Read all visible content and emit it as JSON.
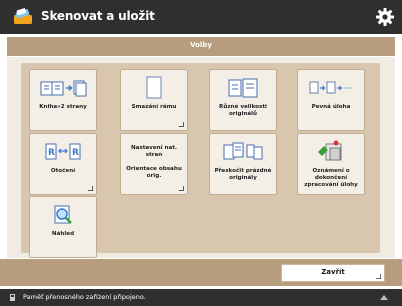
{
  "header": {
    "title": "Skenovat a uložit",
    "settings_icon": "gear-icon"
  },
  "subheader": {
    "title": "Volby"
  },
  "options": [
    {
      "id": "two-sided",
      "label": "Kniha»2 strany",
      "icon": "book-to-two-pages-icon"
    },
    {
      "id": "erase-frame",
      "label": "Smazání rámu",
      "icon": "blank-page-icon"
    },
    {
      "id": "mixed-originals",
      "label": "Různé velikosti originálů",
      "icon": "mixed-size-originals-icon"
    },
    {
      "id": "job-build",
      "label": "Pevná úloha",
      "icon": "job-build-icon"
    },
    {
      "id": "orientation",
      "label": "Otočení",
      "icon": "rotate-page-icon"
    },
    {
      "id": "original-orientation",
      "label_top": "Nastavení nat. stran",
      "label": "Orientace obsahu orig.",
      "icon": "",
      "top_text": true
    },
    {
      "id": "scan-thin",
      "label": "Přeskočit prázdné originály",
      "icon": "skip-blank-icon"
    },
    {
      "id": "send-notify",
      "label": "Oznámení o dokončení zpracování úlohy",
      "icon": "notification-icon"
    },
    {
      "id": "preview",
      "label": "Náhled",
      "icon": "preview-magnifier-icon"
    }
  ],
  "footer": {
    "close_label": "Zavřít"
  },
  "status": {
    "message": "Paměť přenosného zařízení připojeno."
  },
  "colors": {
    "titlebar": "#2f2f2f",
    "accent": "#b79d7d",
    "panel": "#d8c6ae",
    "tile": "#f3eee6"
  }
}
